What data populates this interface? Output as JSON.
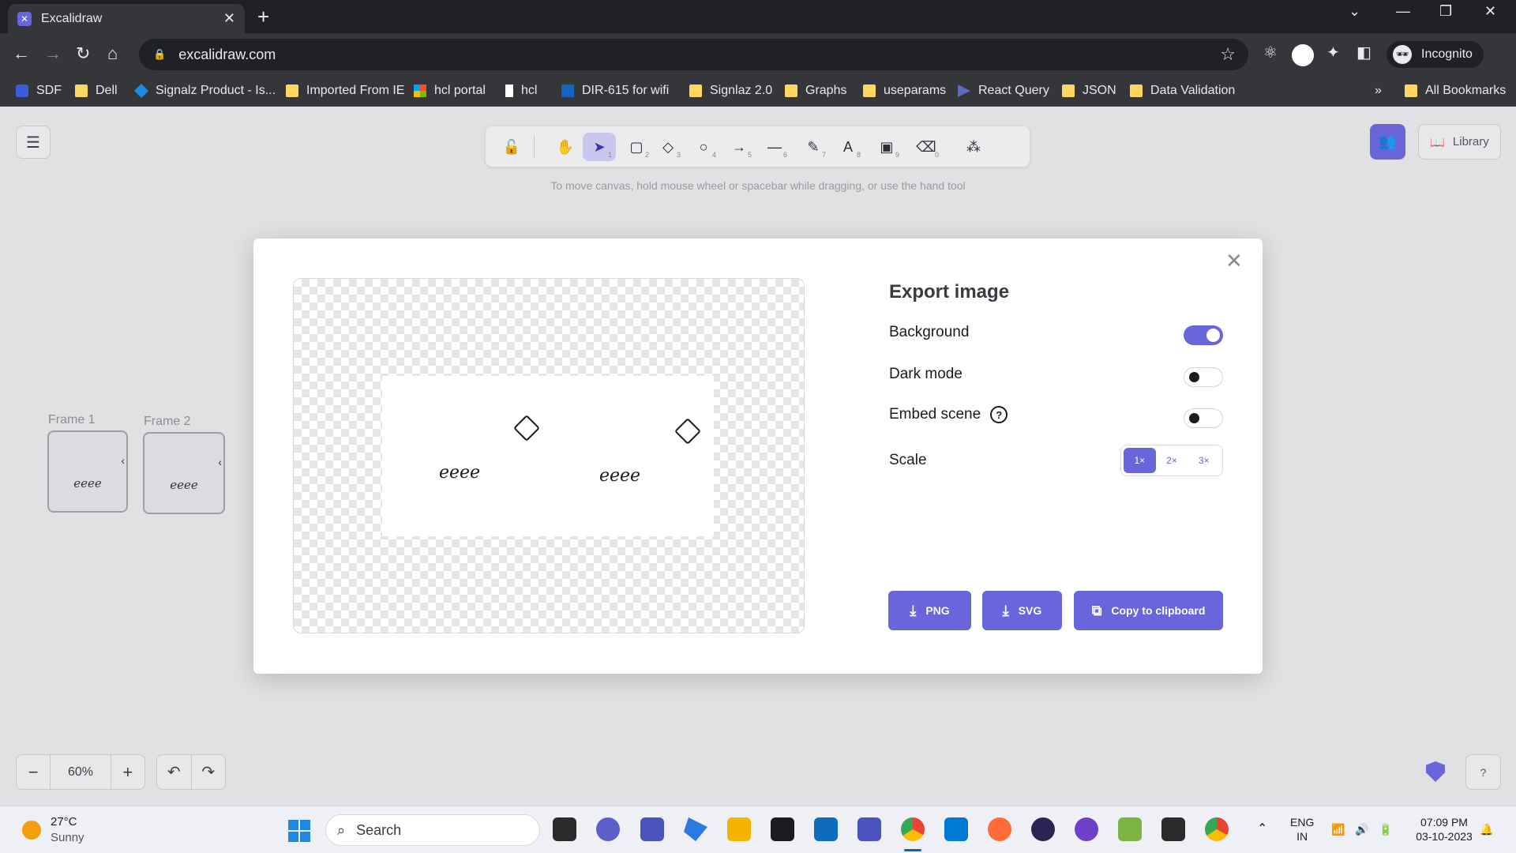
{
  "browser": {
    "tab_title": "Excalidraw",
    "url": "excalidraw.com",
    "profile_label": "Incognito",
    "bookmarks": [
      "SDF",
      "Dell",
      "Signalz Product - Is...",
      "Imported From IE",
      "hcl portal",
      "hcl",
      "DIR-615 for wifi",
      "Signlaz 2.0",
      "Graphs",
      "useparams",
      "React Query",
      "JSON",
      "Data Validation"
    ],
    "bookmarks_more": "»",
    "all_bookmarks": "All Bookmarks"
  },
  "toolbar": {
    "tools": [
      {
        "name": "lock-icon",
        "glyph": "🔓",
        "num": ""
      },
      {
        "name": "hand-icon",
        "glyph": "✋",
        "num": ""
      },
      {
        "name": "selection-icon",
        "glyph": "➤",
        "num": "1"
      },
      {
        "name": "rectangle-icon",
        "glyph": "▢",
        "num": "2"
      },
      {
        "name": "diamond-icon",
        "glyph": "◇",
        "num": "3"
      },
      {
        "name": "ellipse-icon",
        "glyph": "○",
        "num": "4"
      },
      {
        "name": "arrow-icon",
        "glyph": "→",
        "num": "5"
      },
      {
        "name": "line-icon",
        "glyph": "—",
        "num": "6"
      },
      {
        "name": "pencil-icon",
        "glyph": "✎",
        "num": "7"
      },
      {
        "name": "text-icon",
        "glyph": "A",
        "num": "8"
      },
      {
        "name": "image-icon",
        "glyph": "▣",
        "num": "9"
      },
      {
        "name": "eraser-icon",
        "glyph": "⌫",
        "num": "0"
      },
      {
        "name": "shapes-icon",
        "glyph": "⁂",
        "num": ""
      }
    ],
    "hint": "To move canvas, hold mouse wheel or spacebar while dragging, or use the hand tool"
  },
  "header": {
    "library_label": "Library"
  },
  "canvas": {
    "frames": [
      {
        "label": "Frame 1",
        "text": "eeee"
      },
      {
        "label": "Frame 2",
        "text": "eeee"
      }
    ]
  },
  "footer": {
    "zoom": "60%",
    "zoom_out": "−",
    "zoom_in": "+"
  },
  "export_dialog": {
    "title": "Export image",
    "preview_texts": [
      "eeee",
      "eeee"
    ],
    "options": {
      "background": {
        "label": "Background",
        "checked": true
      },
      "dark_mode": {
        "label": "Dark mode",
        "checked": false
      },
      "embed_scene": {
        "label": "Embed scene",
        "checked": false
      }
    },
    "scale_label": "Scale",
    "scale_options": [
      "1×",
      "2×",
      "3×"
    ],
    "scale_selected": "1×",
    "buttons": {
      "png": "PNG",
      "svg": "SVG",
      "copy": "Copy to clipboard"
    }
  },
  "taskbar": {
    "temperature": "27°C",
    "weather": "Sunny",
    "search_placeholder": "Search",
    "lang_1": "ENG",
    "lang_2": "IN",
    "time": "07:09 PM",
    "date": "03-10-2023"
  },
  "colors": {
    "accent": "#6965db",
    "accent_light": "#c8c7ed"
  }
}
